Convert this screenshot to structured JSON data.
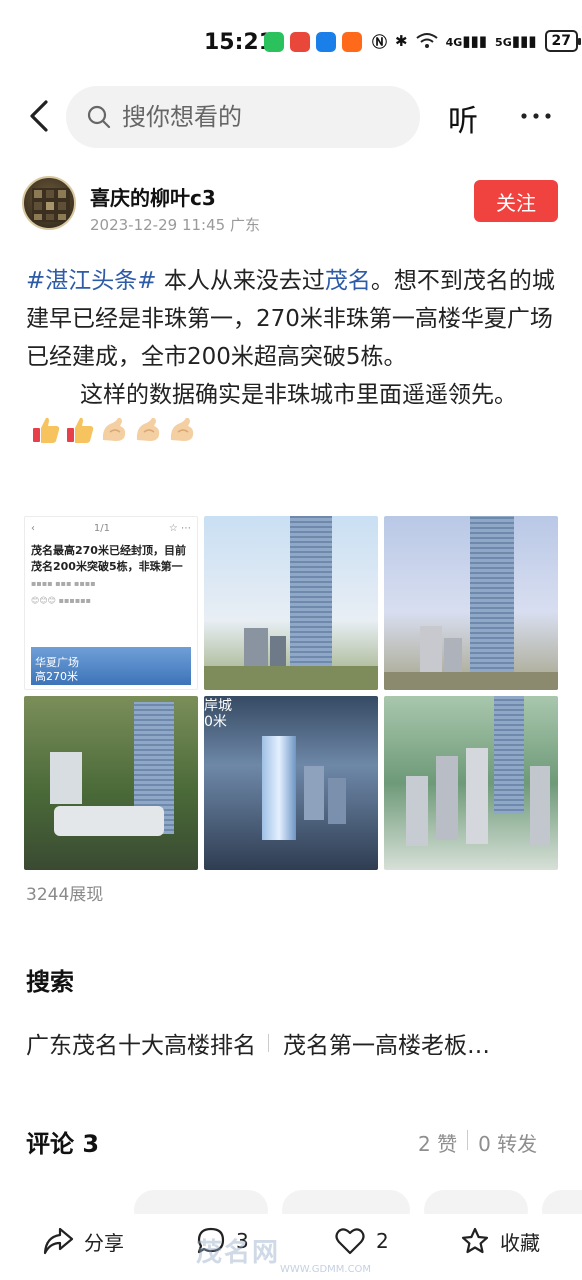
{
  "status_bar": {
    "time": "15:21",
    "network_4g": "4G",
    "network_5g": "5G",
    "battery": "27"
  },
  "nav": {
    "search_placeholder": "搜你想看的",
    "listen_label": "听"
  },
  "author": {
    "name": "喜庆的柳叶c3",
    "date": "2023-12-29 11:45",
    "location": "广东",
    "follow_label": "关注"
  },
  "article": {
    "topic": "#湛江头条#",
    "text_1": " 本人从来没去过",
    "place": "茂名",
    "text_2": "。想不到茂名的城建早已经是非珠第一，270米非珠第一高楼华夏广场已经建成，全市200米超高突破5栋。",
    "text_3": "这样的数据确实是非珠城市里面遥遥领先。"
  },
  "images": {
    "first_tile": {
      "page_indicator": "1/1",
      "headline": "茂名最高270米已经封顶，目前茂名200米突破5栋，非珠第一",
      "caption_line1": "华夏广场",
      "caption_line2": "高270米"
    },
    "fifth_tile_label_1": "岸城",
    "fifth_tile_label_2": "0米"
  },
  "views_label": "3244展现",
  "search_section": {
    "title": "搜索",
    "suggestions": [
      "广东茂名十大高楼排名",
      "茂名第一高楼老板…"
    ]
  },
  "comments": {
    "title": "评论 3",
    "likes": "2 赞",
    "shares": "0 转发"
  },
  "bottom_bar": {
    "share_label": "分享",
    "comment_count": "3",
    "like_count": "2",
    "favorite_label": "收藏"
  },
  "watermark": {
    "brand": "茂名网",
    "url": "WWW.GDMM.COM"
  },
  "colors": {
    "follow_red": "#f0423f",
    "topic_blue": "#2d5ba8"
  }
}
